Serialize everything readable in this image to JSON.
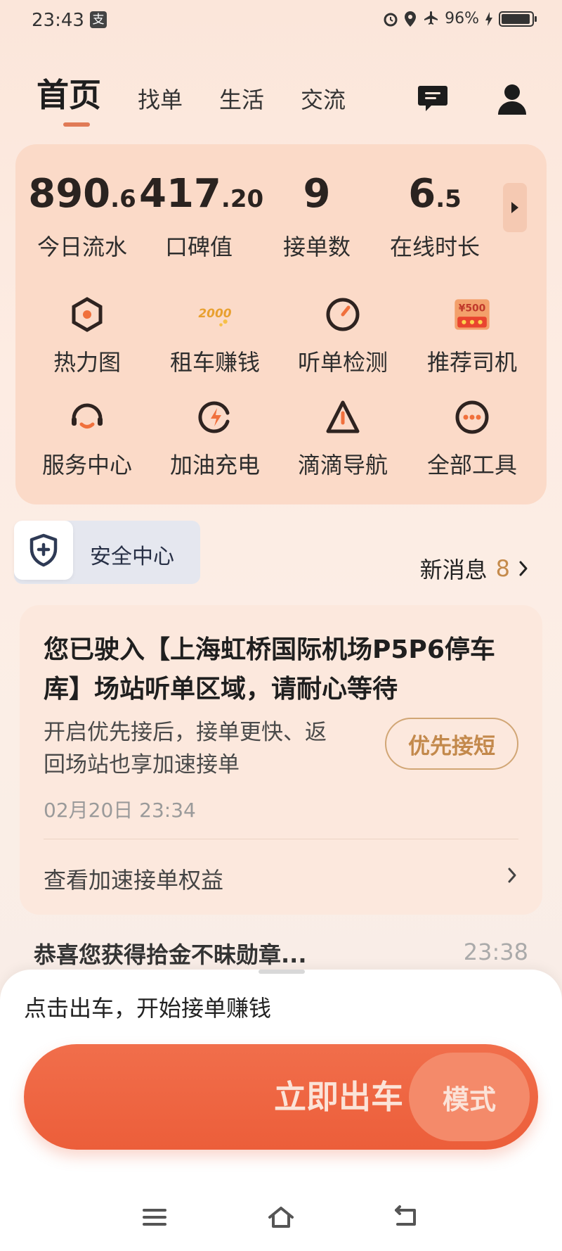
{
  "status_bar": {
    "time": "23:43",
    "app_badge": "支",
    "battery_pct": "96%",
    "icons": [
      "alarm-icon",
      "location-icon",
      "airplane-icon",
      "charging-icon",
      "battery-icon"
    ]
  },
  "tabs": [
    {
      "label": "首页",
      "active": true
    },
    {
      "label": "找单",
      "active": false
    },
    {
      "label": "生活",
      "active": false
    },
    {
      "label": "交流",
      "active": false
    }
  ],
  "stats": [
    {
      "int": "890",
      "dec": ".6",
      "label": "今日流水"
    },
    {
      "int": "417",
      "dec": ".20",
      "label": "口碑值"
    },
    {
      "int": "9",
      "dec": "",
      "label": "接单数"
    },
    {
      "int": "6",
      "dec": ".5",
      "label": "在线时长"
    }
  ],
  "tools": [
    {
      "label": "热力图",
      "icon": "heatmap-icon"
    },
    {
      "label": "租车赚钱",
      "icon": "rent-car-icon",
      "badge": "2000"
    },
    {
      "label": "听单检测",
      "icon": "gauge-icon"
    },
    {
      "label": "推荐司机",
      "icon": "refer-driver-icon",
      "badge": "¥500"
    },
    {
      "label": "服务中心",
      "icon": "headset-icon"
    },
    {
      "label": "加油充电",
      "icon": "charge-icon"
    },
    {
      "label": "滴滴导航",
      "icon": "navigation-icon"
    },
    {
      "label": "全部工具",
      "icon": "more-tools-icon"
    }
  ],
  "safety": {
    "label": "安全中心"
  },
  "new_messages": {
    "label": "新消息",
    "count": "8"
  },
  "notice": {
    "title": "您已驶入【上海虹桥国际机场P5P6停车库】场站听单区域，请耐心等待",
    "desc": "开启优先接后，接单更快、返回场站也享加速接单",
    "button": "优先接短",
    "date": "02月20日 23:34",
    "link": "查看加速接单权益"
  },
  "peek": {
    "text": "恭喜您获得拾金不昧勋章...",
    "time": "23:38"
  },
  "bottom": {
    "hint": "点击出车，开始接单赚钱",
    "go_label": "立即出车",
    "mode_label": "模式"
  },
  "colors": {
    "accent": "#EC5E3A",
    "gold": "#C58B4C",
    "tab_indicator": "#E07A56"
  }
}
